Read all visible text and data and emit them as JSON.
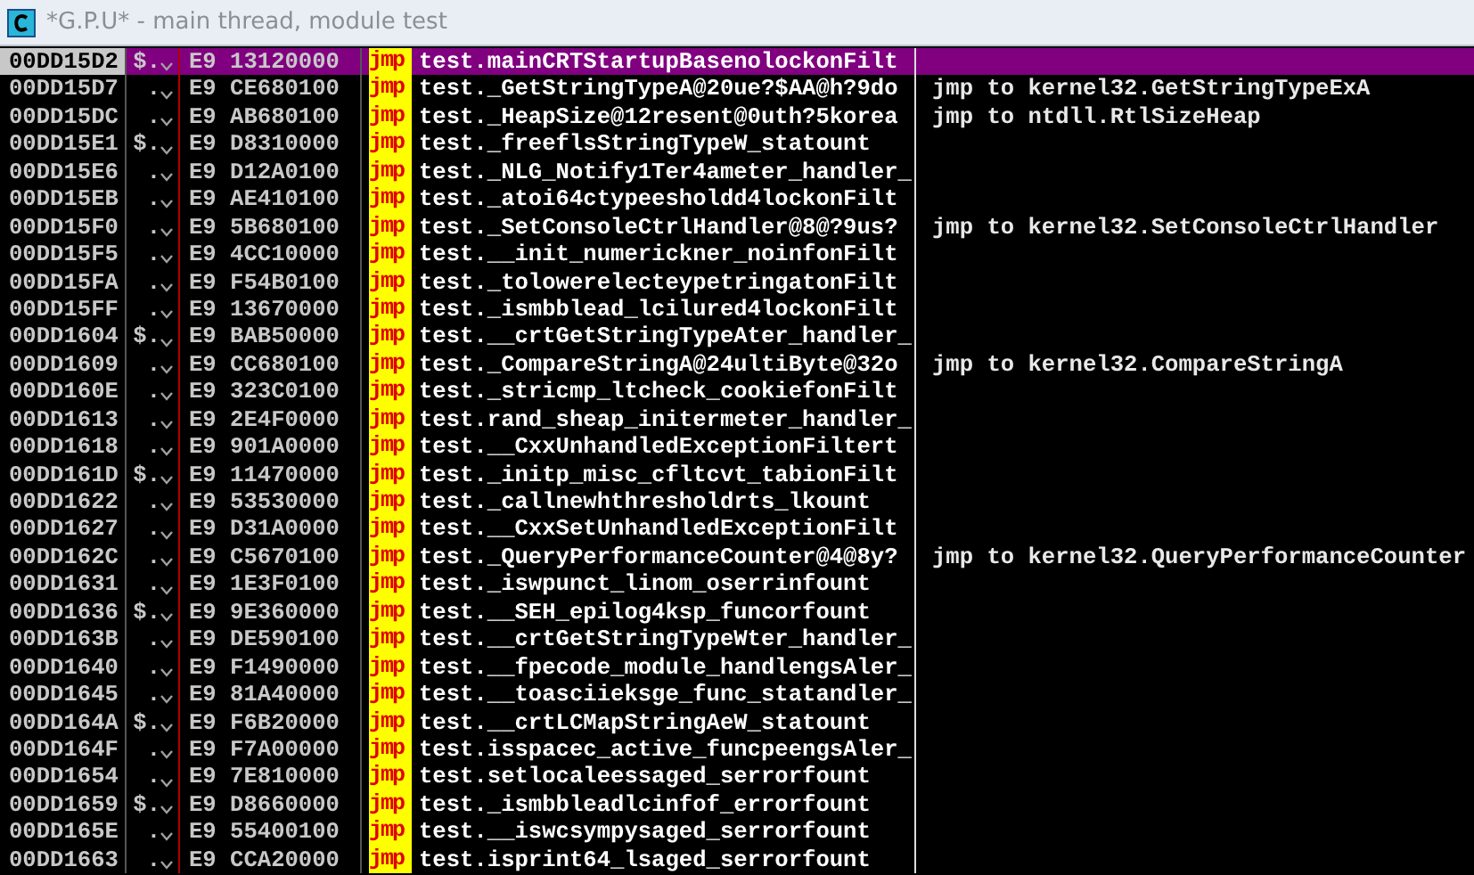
{
  "window": {
    "title": "*G.P.U* - main thread, module test"
  },
  "rows": [
    {
      "address": "00DD15D2",
      "marker": "$.",
      "bytes": "E9 13120000",
      "mnemonic": "jmp",
      "operand": "test.mainCRTStartupBasenolockonFilt",
      "selected": true
    },
    {
      "address": "00DD15D7",
      "marker": ".",
      "bytes": "E9 CE680100",
      "mnemonic": "jmp",
      "operand": "test._GetStringTypeA@20ue?$AA@h?9do",
      "comment": "jmp to kernel32.GetStringTypeExA",
      "selected": false
    },
    {
      "address": "00DD15DC",
      "marker": ".",
      "bytes": "E9 AB680100",
      "mnemonic": "jmp",
      "operand": "test._HeapSize@12resent@0uth?5korea",
      "comment": "jmp to ntdll.RtlSizeHeap",
      "selected": false
    },
    {
      "address": "00DD15E1",
      "marker": "$.",
      "bytes": "E9 D8310000",
      "mnemonic": "jmp",
      "operand": "test._freeflsStringTypeW_statount",
      "selected": false
    },
    {
      "address": "00DD15E6",
      "marker": ".",
      "bytes": "E9 D12A0100",
      "mnemonic": "jmp",
      "operand": "test._NLG_Notify1Ter4ameter_handler_",
      "selected": false
    },
    {
      "address": "00DD15EB",
      "marker": ".",
      "bytes": "E9 AE410100",
      "mnemonic": "jmp",
      "operand": "test._atoi64ctypeesholdd4lockonFilt",
      "selected": false
    },
    {
      "address": "00DD15F0",
      "marker": ".",
      "bytes": "E9 5B680100",
      "mnemonic": "jmp",
      "operand": "test._SetConsoleCtrlHandler@8@?9us?",
      "comment": "jmp to kernel32.SetConsoleCtrlHandler",
      "selected": false
    },
    {
      "address": "00DD15F5",
      "marker": ".",
      "bytes": "E9 4CC10000",
      "mnemonic": "jmp",
      "operand": "test.__init_numerickner_noinfonFilt",
      "selected": false
    },
    {
      "address": "00DD15FA",
      "marker": ".",
      "bytes": "E9 F54B0100",
      "mnemonic": "jmp",
      "operand": "test._tolowerelecteypetringatonFilt",
      "selected": false
    },
    {
      "address": "00DD15FF",
      "marker": ".",
      "bytes": "E9 13670000",
      "mnemonic": "jmp",
      "operand": "test._ismbblead_lcilured4lockonFilt",
      "selected": false
    },
    {
      "address": "00DD1604",
      "marker": "$.",
      "bytes": "E9 BAB50000",
      "mnemonic": "jmp",
      "operand": "test.__crtGetStringTypeAter_handler_",
      "selected": false
    },
    {
      "address": "00DD1609",
      "marker": ".",
      "bytes": "E9 CC680100",
      "mnemonic": "jmp",
      "operand": "test._CompareStringA@24ultiByte@32o",
      "comment": "jmp to kernel32.CompareStringA",
      "selected": false
    },
    {
      "address": "00DD160E",
      "marker": ".",
      "bytes": "E9 323C0100",
      "mnemonic": "jmp",
      "operand": "test._stricmp_ltcheck_cookiefonFilt",
      "selected": false
    },
    {
      "address": "00DD1613",
      "marker": ".",
      "bytes": "E9 2E4F0000",
      "mnemonic": "jmp",
      "operand": "test.rand_sheap_initermeter_handler_",
      "selected": false
    },
    {
      "address": "00DD1618",
      "marker": ".",
      "bytes": "E9 901A0000",
      "mnemonic": "jmp",
      "operand": "test.__CxxUnhandledExceptionFiltert",
      "selected": false
    },
    {
      "address": "00DD161D",
      "marker": "$.",
      "bytes": "E9 11470000",
      "mnemonic": "jmp",
      "operand": "test._initp_misc_cfltcvt_tabionFilt",
      "selected": false
    },
    {
      "address": "00DD1622",
      "marker": ".",
      "bytes": "E9 53530000",
      "mnemonic": "jmp",
      "operand": "test._callnewhthresholdrts_lkount",
      "selected": false
    },
    {
      "address": "00DD1627",
      "marker": ".",
      "bytes": "E9 D31A0000",
      "mnemonic": "jmp",
      "operand": "test.__CxxSetUnhandledExceptionFilt",
      "selected": false
    },
    {
      "address": "00DD162C",
      "marker": ".",
      "bytes": "E9 C5670100",
      "mnemonic": "jmp",
      "operand": "test._QueryPerformanceCounter@4@8y?",
      "comment": "jmp to kernel32.QueryPerformanceCounter",
      "selected": false
    },
    {
      "address": "00DD1631",
      "marker": ".",
      "bytes": "E9 1E3F0100",
      "mnemonic": "jmp",
      "operand": "test._iswpunct_linom_oserrinfount",
      "selected": false
    },
    {
      "address": "00DD1636",
      "marker": "$.",
      "bytes": "E9 9E360000",
      "mnemonic": "jmp",
      "operand": "test.__SEH_epilog4ksp_funcorfount",
      "selected": false
    },
    {
      "address": "00DD163B",
      "marker": ".",
      "bytes": "E9 DE590100",
      "mnemonic": "jmp",
      "operand": "test.__crtGetStringTypeWter_handler_",
      "selected": false
    },
    {
      "address": "00DD1640",
      "marker": ".",
      "bytes": "E9 F1490000",
      "mnemonic": "jmp",
      "operand": "test.__fpecode_module_handlengsAler_",
      "selected": false
    },
    {
      "address": "00DD1645",
      "marker": ".",
      "bytes": "E9 81A40000",
      "mnemonic": "jmp",
      "operand": "test.__toasciieksge_func_statandler_",
      "selected": false
    },
    {
      "address": "00DD164A",
      "marker": "$.",
      "bytes": "E9 F6B20000",
      "mnemonic": "jmp",
      "operand": "test.__crtLCMapStringAeW_statount",
      "selected": false
    },
    {
      "address": "00DD164F",
      "marker": ".",
      "bytes": "E9 F7A00000",
      "mnemonic": "jmp",
      "operand": "test.isspacec_active_funcpeengsAler_",
      "selected": false
    },
    {
      "address": "00DD1654",
      "marker": ".",
      "bytes": "E9 7E810000",
      "mnemonic": "jmp",
      "operand": "test.setlocaleessaged_serrorfount",
      "selected": false
    },
    {
      "address": "00DD1659",
      "marker": "$.",
      "bytes": "E9 D8660000",
      "mnemonic": "jmp",
      "operand": "test._ismbbleadlcinfof_errorfount",
      "selected": false
    },
    {
      "address": "00DD165E",
      "marker": ".",
      "bytes": "E9 55400100",
      "mnemonic": "jmp",
      "operand": "test.__iswcsympysaged_serrorfount",
      "selected": false
    },
    {
      "address": "00DD1663",
      "marker": ".",
      "bytes": "E9 CCA20000",
      "mnemonic": "jmp",
      "operand": "test.isprint64_lsaged_serrorfount",
      "selected": false
    }
  ]
}
